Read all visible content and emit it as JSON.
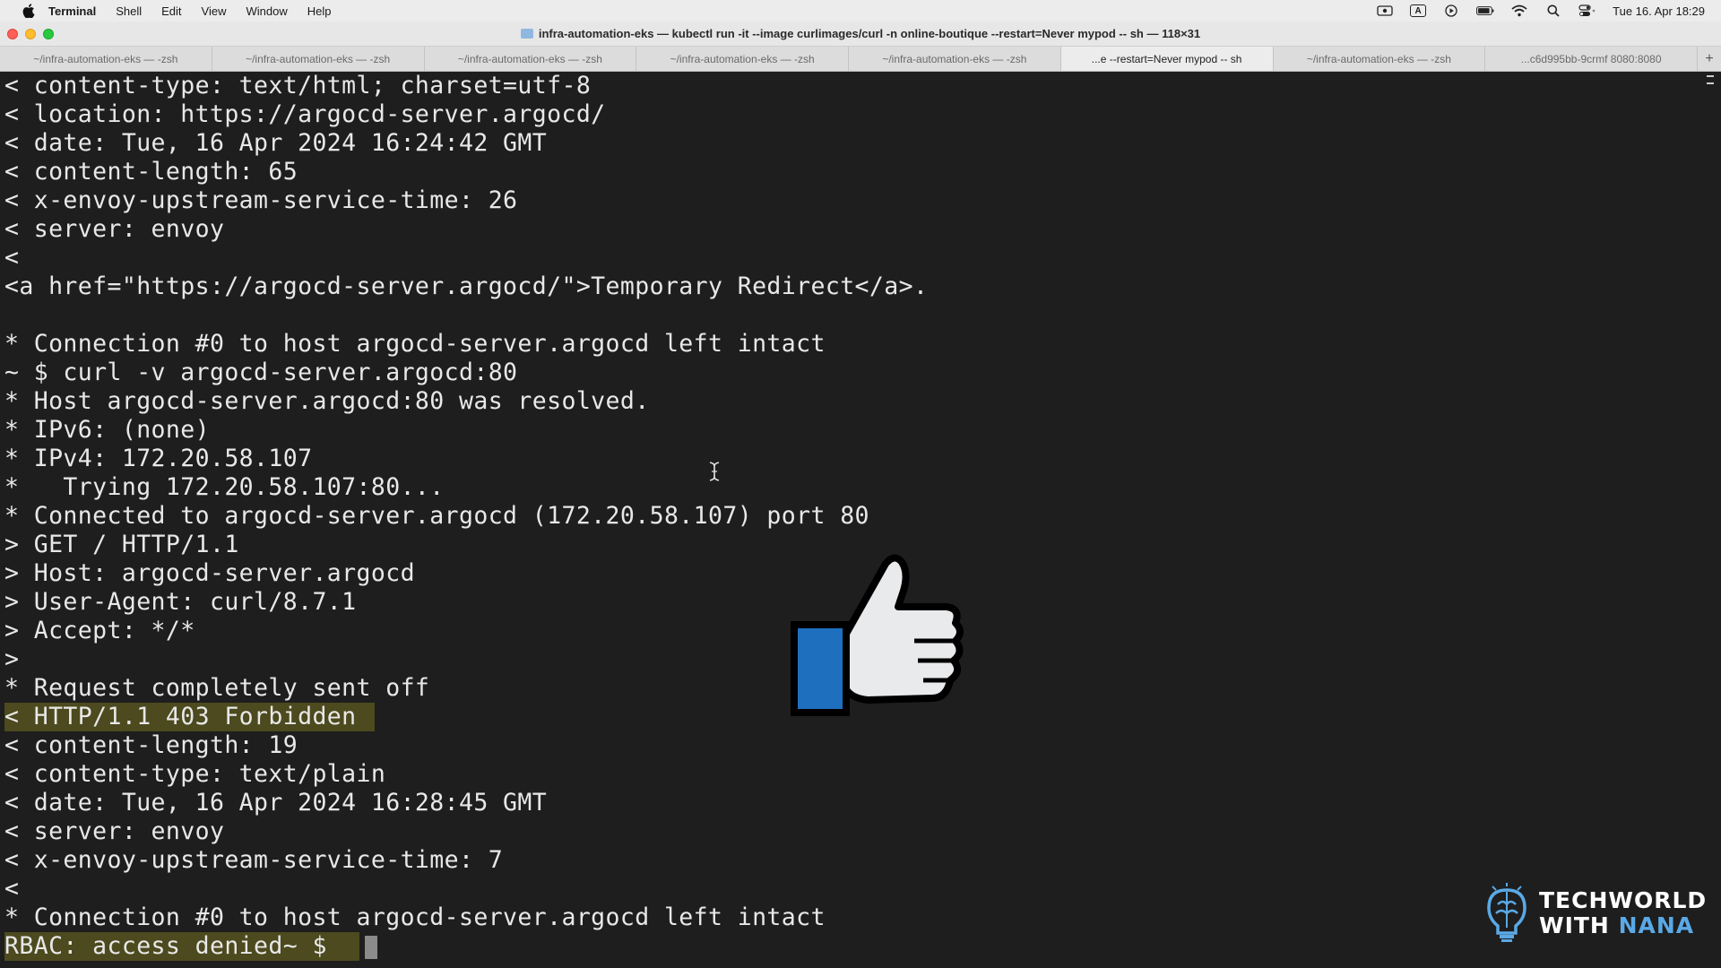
{
  "menubar": {
    "app_name": "Terminal",
    "items": [
      "Shell",
      "Edit",
      "View",
      "Window",
      "Help"
    ],
    "clock": "Tue 16. Apr  18:29",
    "input_indicator": "A"
  },
  "window": {
    "title": "infra-automation-eks — kubectl run -it --image curlimages/curl -n online-boutique --restart=Never mypod -- sh — 118×31"
  },
  "tabs": [
    {
      "label": "~/infra-automation-eks — -zsh",
      "active": false
    },
    {
      "label": "~/infra-automation-eks — -zsh",
      "active": false
    },
    {
      "label": "~/infra-automation-eks — -zsh",
      "active": false
    },
    {
      "label": "~/infra-automation-eks — -zsh",
      "active": false
    },
    {
      "label": "~/infra-automation-eks — -zsh",
      "active": false
    },
    {
      "label": "...e --restart=Never mypod -- sh",
      "active": true
    },
    {
      "label": "~/infra-automation-eks — -zsh",
      "active": false
    },
    {
      "label": "...c6d995bb-9crmf 8080:8080",
      "active": false
    }
  ],
  "tab_add_label": "+",
  "terminal": {
    "lines": [
      {
        "text": "< content-type: text/html; charset=utf-8",
        "highlight": false
      },
      {
        "text": "< location: https://argocd-server.argocd/",
        "highlight": false
      },
      {
        "text": "< date: Tue, 16 Apr 2024 16:24:42 GMT",
        "highlight": false
      },
      {
        "text": "< content-length: 65",
        "highlight": false
      },
      {
        "text": "< x-envoy-upstream-service-time: 26",
        "highlight": false
      },
      {
        "text": "< server: envoy",
        "highlight": false
      },
      {
        "text": "<",
        "highlight": false
      },
      {
        "text": "<a href=\"https://argocd-server.argocd/\">Temporary Redirect</a>.",
        "highlight": false
      },
      {
        "text": "",
        "highlight": false
      },
      {
        "text": "* Connection #0 to host argocd-server.argocd left intact",
        "highlight": false
      },
      {
        "text": "~ $ curl -v argocd-server.argocd:80",
        "highlight": false
      },
      {
        "text": "* Host argocd-server.argocd:80 was resolved.",
        "highlight": false
      },
      {
        "text": "* IPv6: (none)",
        "highlight": false
      },
      {
        "text": "* IPv4: 172.20.58.107",
        "highlight": false
      },
      {
        "text": "*   Trying 172.20.58.107:80...",
        "highlight": false
      },
      {
        "text": "* Connected to argocd-server.argocd (172.20.58.107) port 80",
        "highlight": false
      },
      {
        "text": "> GET / HTTP/1.1",
        "highlight": false
      },
      {
        "text": "> Host: argocd-server.argocd",
        "highlight": false
      },
      {
        "text": "> User-Agent: curl/8.7.1",
        "highlight": false
      },
      {
        "text": "> Accept: */*",
        "highlight": false
      },
      {
        "text": ">",
        "highlight": false
      },
      {
        "text": "* Request completely sent off",
        "highlight": false
      },
      {
        "text": "< HTTP/1.1 403 Forbidden",
        "highlight": true
      },
      {
        "text": "< content-length: 19",
        "highlight": false
      },
      {
        "text": "< content-type: text/plain",
        "highlight": false
      },
      {
        "text": "< date: Tue, 16 Apr 2024 16:28:45 GMT",
        "highlight": false
      },
      {
        "text": "< server: envoy",
        "highlight": false
      },
      {
        "text": "< x-envoy-upstream-service-time: 7",
        "highlight": false
      },
      {
        "text": "<",
        "highlight": false
      },
      {
        "text": "* Connection #0 to host argocd-server.argocd left intact",
        "highlight": false
      },
      {
        "text": "RBAC: access denied~ $ ",
        "highlight": true,
        "cursor": true
      }
    ]
  },
  "watermark": {
    "line1": "TECHWORLD",
    "line2_prefix": "WITH ",
    "line2_accent": "NANA"
  },
  "colors": {
    "terminal_bg": "#1e1e1e",
    "terminal_fg": "#e8e8e8",
    "highlight_bg": "#4c4a1e",
    "thumb_blue": "#1f6fbf",
    "watermark_accent": "#5aa9e6"
  }
}
